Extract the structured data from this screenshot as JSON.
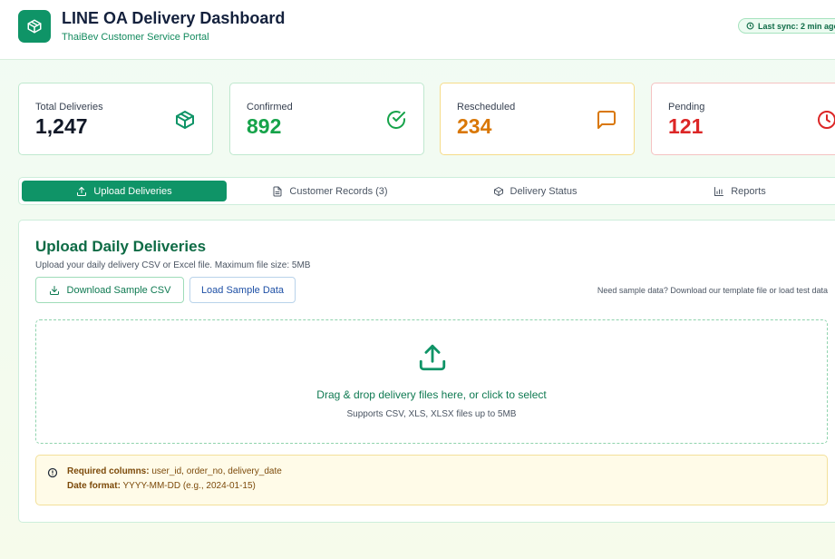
{
  "header": {
    "title": "LINE OA Delivery Dashboard",
    "subtitle": "ThaiBev Customer Service Portal",
    "sync_status": "Last sync: 2 min ago",
    "logo_icon": "package-icon"
  },
  "stats": [
    {
      "label": "Total Deliveries",
      "value": "1,247",
      "color": "#111827",
      "icon": "package-icon"
    },
    {
      "label": "Confirmed",
      "value": "892",
      "color": "#16a34a",
      "icon": "check-circle-icon"
    },
    {
      "label": "Rescheduled",
      "value": "234",
      "color": "#d97706",
      "icon": "message-square-icon"
    },
    {
      "label": "Pending",
      "value": "121",
      "color": "#dc2626",
      "icon": "clock-icon"
    }
  ],
  "tabs": [
    {
      "label": "Upload Deliveries",
      "icon": "upload-icon",
      "active": true
    },
    {
      "label": "Customer Records (3)",
      "icon": "file-text-icon",
      "active": false
    },
    {
      "label": "Delivery Status",
      "icon": "package-icon",
      "active": false
    },
    {
      "label": "Reports",
      "icon": "bar-chart-icon",
      "active": false
    }
  ],
  "upload": {
    "title": "Upload Daily Deliveries",
    "description": "Upload your daily delivery CSV or Excel file. Maximum file size: 5MB",
    "download_button": "Download Sample CSV",
    "load_button": "Load Sample Data",
    "hint": "Need sample data? Download our template file or load test data",
    "dropzone_text": "Drag & drop delivery files here, or click to select",
    "dropzone_subtext": "Supports CSV, XLS, XLSX files up to 5MB"
  },
  "requirements": {
    "columns_label": "Required columns:",
    "columns_value": "user_id, order_no, delivery_date",
    "format_label": "Date format:",
    "format_value": "YYYY-MM-DD (e.g., 2024-01-15)"
  },
  "colors": {
    "brand": "#0f9467",
    "confirmed": "#16a34a",
    "rescheduled": "#d97706",
    "pending": "#dc2626"
  }
}
